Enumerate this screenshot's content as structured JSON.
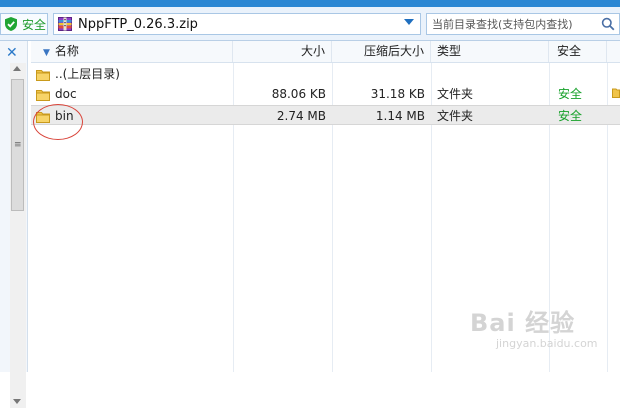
{
  "toolbar": {
    "safe_label": "安全",
    "path": "NppFTP_0.26.3.zip",
    "search_placeholder": "当前目录查找(支持包内查找)"
  },
  "columns": {
    "name": "名称",
    "size": "大小",
    "compressed": "压缩后大小",
    "type": "类型",
    "safety": "安全"
  },
  "rows": [
    {
      "name": "..(上层目录)",
      "size": "",
      "compressed": "",
      "type": "",
      "safety": "",
      "extra": ""
    },
    {
      "name": "doc",
      "size": "88.06 KB",
      "compressed": "31.18 KB",
      "type": "文件夹",
      "safety": "安全",
      "extra": ""
    },
    {
      "name": "bin",
      "size": "2.74 MB",
      "compressed": "1.14 MB",
      "type": "文件夹",
      "safety": "安全",
      "extra": ""
    }
  ],
  "watermark": {
    "logo": "Bai 经验",
    "url": "jingyan.baidu.com"
  },
  "colors": {
    "accent": "#2b87d3",
    "safe_green": "#17a12a",
    "annotation_red": "#d9443a"
  }
}
